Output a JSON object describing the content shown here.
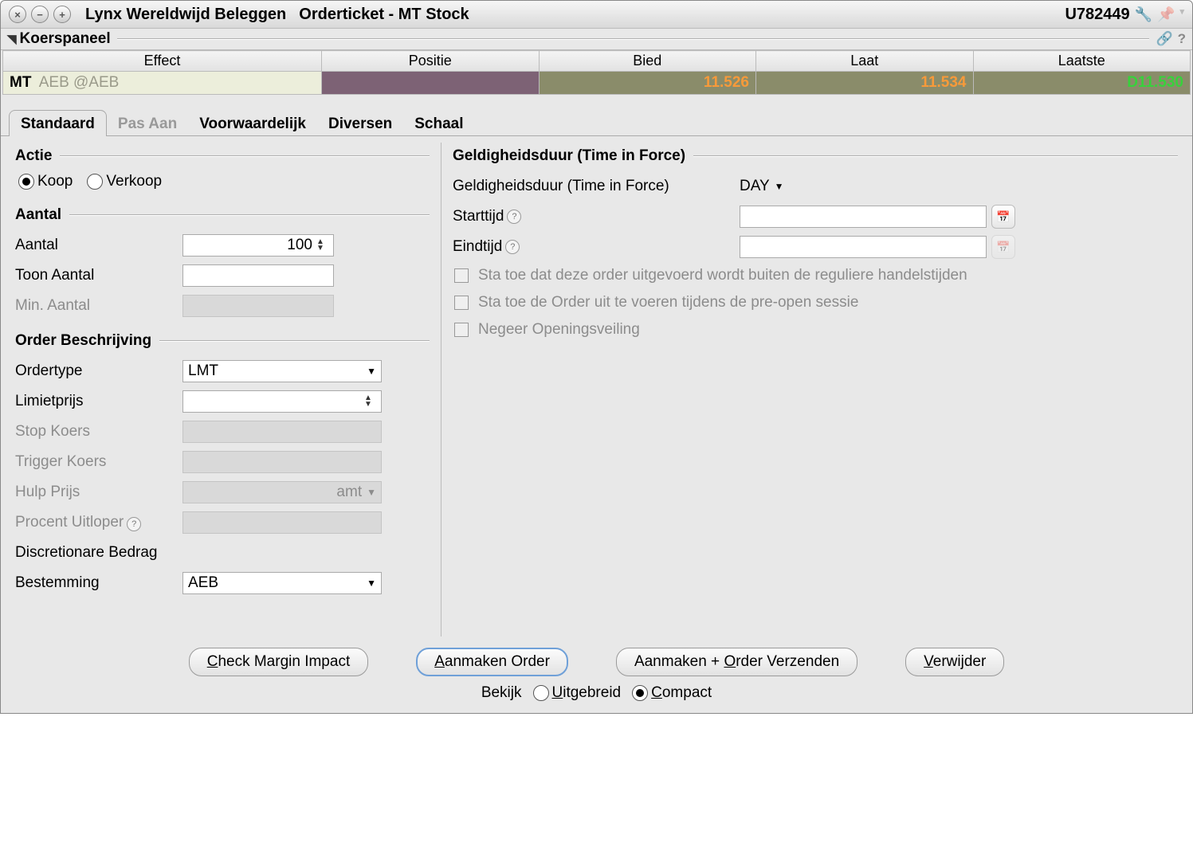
{
  "titlebar": {
    "app": "Lynx Wereldwijd Beleggen",
    "title": "Orderticket - MT Stock",
    "account": "U782449"
  },
  "panel": {
    "title": "Koerspaneel"
  },
  "quote": {
    "headers": {
      "effect": "Effect",
      "positie": "Positie",
      "bied": "Bied",
      "laat": "Laat",
      "laatste": "Laatste"
    },
    "row": {
      "symbol": "MT",
      "exchange": "AEB @AEB",
      "positie": "",
      "bied": "11.526",
      "laat": "11.534",
      "laatste_prefix": "D",
      "laatste": "11.530"
    }
  },
  "tabs": {
    "standaard": "Standaard",
    "pas_aan": "Pas Aan",
    "voorwaardelijk": "Voorwaardelijk",
    "diversen": "Diversen",
    "schaal": "Schaal"
  },
  "left": {
    "actie_title": "Actie",
    "koop": "Koop",
    "verkoop": "Verkoop",
    "aantal_title": "Aantal",
    "aantal_lbl": "Aantal",
    "aantal_val": "100",
    "toon_lbl": "Toon Aantal",
    "toon_val": "",
    "min_lbl": "Min. Aantal",
    "ob_title": "Order Beschrijving",
    "ordertype_lbl": "Ordertype",
    "ordertype_val": "LMT",
    "limiet_lbl": "Limietprijs",
    "limiet_val": "",
    "stop_lbl": "Stop Koers",
    "trigger_lbl": "Trigger Koers",
    "hulp_lbl": "Hulp Prijs",
    "hulp_val": "amt",
    "procent_lbl": "Procent Uitloper",
    "discr_lbl": "Discretionare Bedrag",
    "best_lbl": "Bestemming",
    "best_val": "AEB"
  },
  "right": {
    "tif_title": "Geldigheidsduur (Time in Force)",
    "tif_lbl": "Geldigheidsduur (Time in Force)",
    "tif_val": "DAY",
    "start_lbl": "Starttijd",
    "start_val": "",
    "eind_lbl": "Eindtijd",
    "eind_val": "",
    "cb1": "Sta toe dat deze order uitgevoerd wordt buiten de reguliere handelstijden",
    "cb2": "Sta toe de Order uit te voeren tijdens de pre-open sessie",
    "cb3": "Negeer Openingsveiling"
  },
  "buttons": {
    "check": "Check Margin Impact",
    "check_u": "C",
    "aanmaken": "Aanmaken Order",
    "aanmaken_u": "A",
    "verzenden": "Aanmaken + Order Verzenden",
    "verzenden_u": "O",
    "verwijder": "Verwijder",
    "verwijder_u": "V"
  },
  "view": {
    "label": "Bekijk",
    "uitgebreid": "Uitgebreid",
    "compact": "Compact"
  }
}
